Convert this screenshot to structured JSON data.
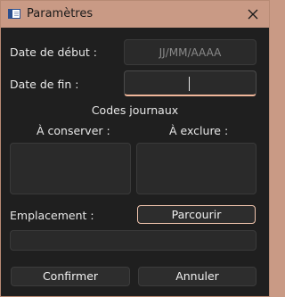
{
  "window": {
    "title": "Paramètres",
    "titlebar_color": "#c99a85",
    "close_icon": "close-icon",
    "app_icon": "window-icon"
  },
  "form": {
    "start_date_label": "Date de début :",
    "start_date_placeholder": "JJ/MM/AAAA",
    "start_date_value": "",
    "end_date_label": "Date de fin :",
    "end_date_value": "",
    "journal_codes_heading": "Codes journaux",
    "keep_label": "À conserver :",
    "exclude_label": "À exclure :",
    "location_label": "Emplacement :",
    "browse_button": "Parcourir",
    "location_value": ""
  },
  "footer": {
    "confirm_button": "Confirmer",
    "cancel_button": "Annuler"
  },
  "colors": {
    "background": "#1f1f1f",
    "field": "#2a2a2a",
    "accent": "#f0b69a"
  }
}
